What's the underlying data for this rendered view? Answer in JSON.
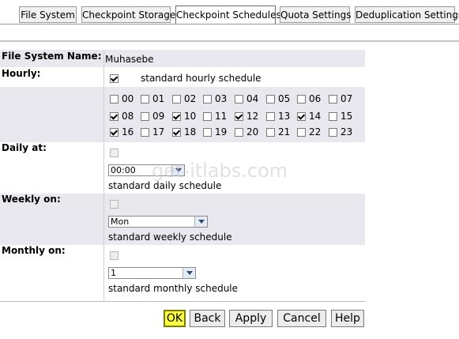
{
  "tabs": [
    {
      "label": "File System",
      "active": false
    },
    {
      "label": "Checkpoint Storage",
      "active": false
    },
    {
      "label": "Checkpoint Schedules",
      "active": true
    },
    {
      "label": "Quota Settings",
      "active": false
    },
    {
      "label": "Deduplication Settings",
      "active": false
    }
  ],
  "form": {
    "file_system_label": "File System Name:",
    "file_system_value": "Muhasebe",
    "hourly_label": "Hourly:",
    "hourly_schedule_label": "standard hourly schedule",
    "hourly_schedule_checked": true,
    "hours": [
      {
        "label": "00",
        "checked": false
      },
      {
        "label": "01",
        "checked": false
      },
      {
        "label": "02",
        "checked": false
      },
      {
        "label": "03",
        "checked": false
      },
      {
        "label": "04",
        "checked": false
      },
      {
        "label": "05",
        "checked": false
      },
      {
        "label": "06",
        "checked": false
      },
      {
        "label": "07",
        "checked": false
      },
      {
        "label": "08",
        "checked": true
      },
      {
        "label": "09",
        "checked": false
      },
      {
        "label": "10",
        "checked": true
      },
      {
        "label": "11",
        "checked": false
      },
      {
        "label": "12",
        "checked": true
      },
      {
        "label": "13",
        "checked": false
      },
      {
        "label": "14",
        "checked": true
      },
      {
        "label": "15",
        "checked": false
      },
      {
        "label": "16",
        "checked": true
      },
      {
        "label": "17",
        "checked": false
      },
      {
        "label": "18",
        "checked": true
      },
      {
        "label": "19",
        "checked": false
      },
      {
        "label": "20",
        "checked": false
      },
      {
        "label": "21",
        "checked": false
      },
      {
        "label": "22",
        "checked": false
      },
      {
        "label": "23",
        "checked": false
      }
    ],
    "daily_label": "Daily at:",
    "daily_time": "00:00",
    "daily_schedule_label": "standard daily schedule",
    "weekly_label": "Weekly on:",
    "weekly_day": "Mon",
    "weekly_schedule_label": "standard weekly schedule",
    "monthly_label": "Monthly on:",
    "monthly_day": "1",
    "monthly_schedule_label": "standard monthly schedule"
  },
  "buttons": {
    "ok": "OK",
    "back": "Back",
    "apply": "Apply",
    "cancel": "Cancel",
    "help": "Help"
  },
  "watermark": "get-itlabs.com"
}
